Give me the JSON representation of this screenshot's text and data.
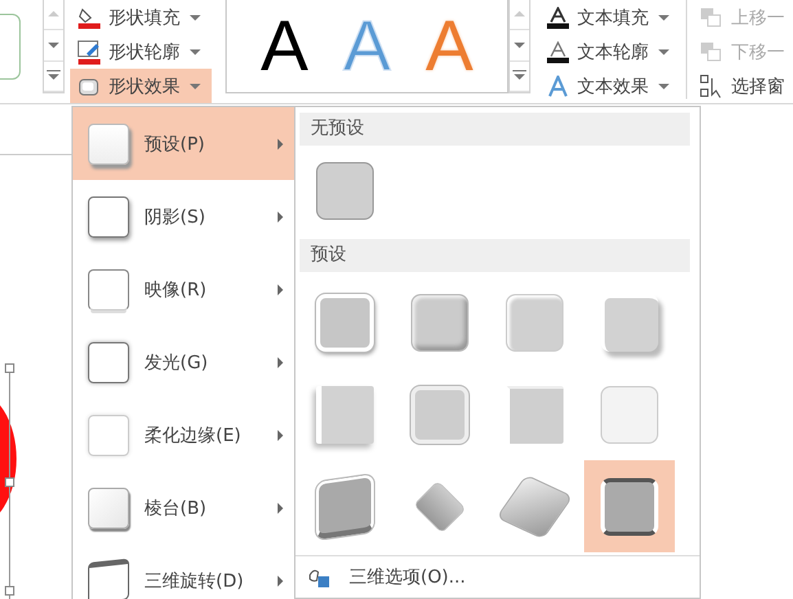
{
  "ribbon": {
    "shape_commands": [
      {
        "label": "形状填充",
        "kind": "fill",
        "selected": false
      },
      {
        "label": "形状轮廓",
        "kind": "outline",
        "selected": false
      },
      {
        "label": "形状效果",
        "kind": "effects",
        "selected": true
      }
    ],
    "wordart_styles": [
      {
        "text": "A",
        "kind": "fill",
        "color": "#000000"
      },
      {
        "text": "A",
        "kind": "fill",
        "color": "#5b9bd5"
      },
      {
        "text": "A",
        "kind": "outline",
        "color": "#ed7d31"
      }
    ],
    "text_commands": [
      {
        "label": "文本填充",
        "kind": "fill"
      },
      {
        "label": "文本轮廓",
        "kind": "outline"
      },
      {
        "label": "文本效果",
        "kind": "effects"
      }
    ],
    "arrange_commands": [
      {
        "label": "上移一",
        "kind": "forward",
        "disabled": true
      },
      {
        "label": "下移一",
        "kind": "backward",
        "disabled": true
      },
      {
        "label": "选择窗",
        "kind": "pane",
        "disabled": false
      }
    ]
  },
  "effects_menu": [
    {
      "label": "预设(P)",
      "kind": "preset",
      "selected": true
    },
    {
      "label": "阴影(S)",
      "kind": "shadow",
      "selected": false
    },
    {
      "label": "映像(R)",
      "kind": "reflection",
      "selected": false
    },
    {
      "label": "发光(G)",
      "kind": "glow",
      "selected": false
    },
    {
      "label": "柔化边缘(E)",
      "kind": "soft-edges",
      "selected": false
    },
    {
      "label": "棱台(B)",
      "kind": "bevel",
      "selected": false
    },
    {
      "label": "三维旋转(D)",
      "kind": "rotation",
      "selected": false
    }
  ],
  "preset_submenu": {
    "sections": [
      {
        "header": "无预设",
        "presets": [
          {
            "selected": false
          }
        ]
      },
      {
        "header": "预设",
        "presets": [
          {
            "selected": false
          },
          {
            "selected": false
          },
          {
            "selected": false
          },
          {
            "selected": false
          },
          {
            "selected": false
          },
          {
            "selected": false
          },
          {
            "selected": false
          },
          {
            "selected": false
          },
          {
            "selected": false
          },
          {
            "selected": false
          },
          {
            "selected": false
          },
          {
            "selected": true
          }
        ]
      }
    ],
    "footer": "三维选项(O)..."
  }
}
